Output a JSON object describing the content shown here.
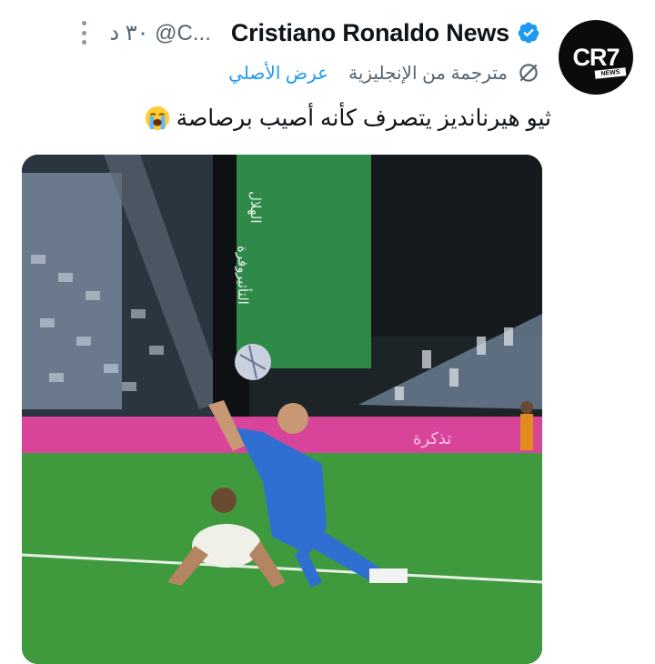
{
  "tweet": {
    "author_name": "Cristiano Ronaldo News",
    "handle": "@C...",
    "time": "٣٠ د",
    "translated_label": "مترجمة من الإنجليزية",
    "show_original_label": "عرض الأصلي",
    "text": "ثيو هيرنانديز يتصرف كأنه أصيب برصاصة",
    "avatar_text": "CR7",
    "avatar_subtext": "NEWS",
    "media_banner_text": [
      "الهلال",
      "وفرة",
      "التأثير"
    ],
    "ad_board_text": "تذكرة"
  },
  "icons": {
    "more": "more-vertical-icon",
    "verified": "verified-badge-icon",
    "translate": "translate-globe-icon",
    "emoji": "loudly-crying-face-emoji"
  },
  "colors": {
    "accent": "#1d9bf0",
    "secondary_text": "#536471",
    "primary_text": "#0f1419",
    "pitch": "#3f9a3e",
    "ad_board": "#e0479a",
    "jersey": "#2f6fd1"
  }
}
